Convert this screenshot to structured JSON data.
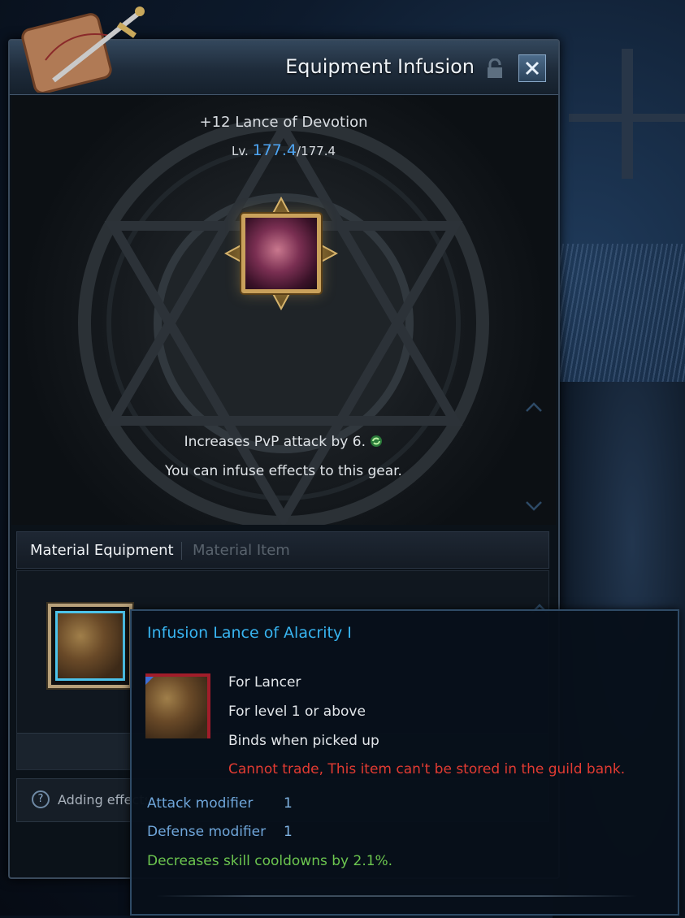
{
  "window": {
    "title": "Equipment Infusion"
  },
  "item": {
    "name": "+12 Lance of Devotion",
    "level_prefix": "Lv.",
    "level_current": "177.4",
    "level_max": "/177.4",
    "effect_lines": [
      "Increases PvP attack by 6.",
      "You can infuse effects to this gear."
    ]
  },
  "tabs": [
    {
      "label": "Material Equipment",
      "active": true
    },
    {
      "label": "Material Item",
      "active": false
    }
  ],
  "help": {
    "text": "Adding effects"
  },
  "tooltip": {
    "title": "Infusion Lance of Alacrity I",
    "lines": [
      "For Lancer",
      "For level 1 or above",
      "Binds when picked up"
    ],
    "warning": "Cannot trade, This item can't be stored in the guild bank.",
    "stats": [
      {
        "label": "Attack modifier",
        "value": "1"
      },
      {
        "label": "Defense modifier",
        "value": "1"
      }
    ],
    "bonus": "Decreases skill cooldowns by 2.1%."
  },
  "icons": {
    "lock": "lock-icon",
    "close": "close-icon",
    "refresh": "refresh-icon",
    "help": "help-icon",
    "scroll_up": "chevron-up-icon",
    "scroll_down": "chevron-down-icon"
  },
  "colors": {
    "level_highlight": "#4ea5f3",
    "tooltip_title": "#38b4f0",
    "warning": "#e23b32",
    "stat_label": "#6fa6da",
    "bonus": "#6cc64f"
  }
}
